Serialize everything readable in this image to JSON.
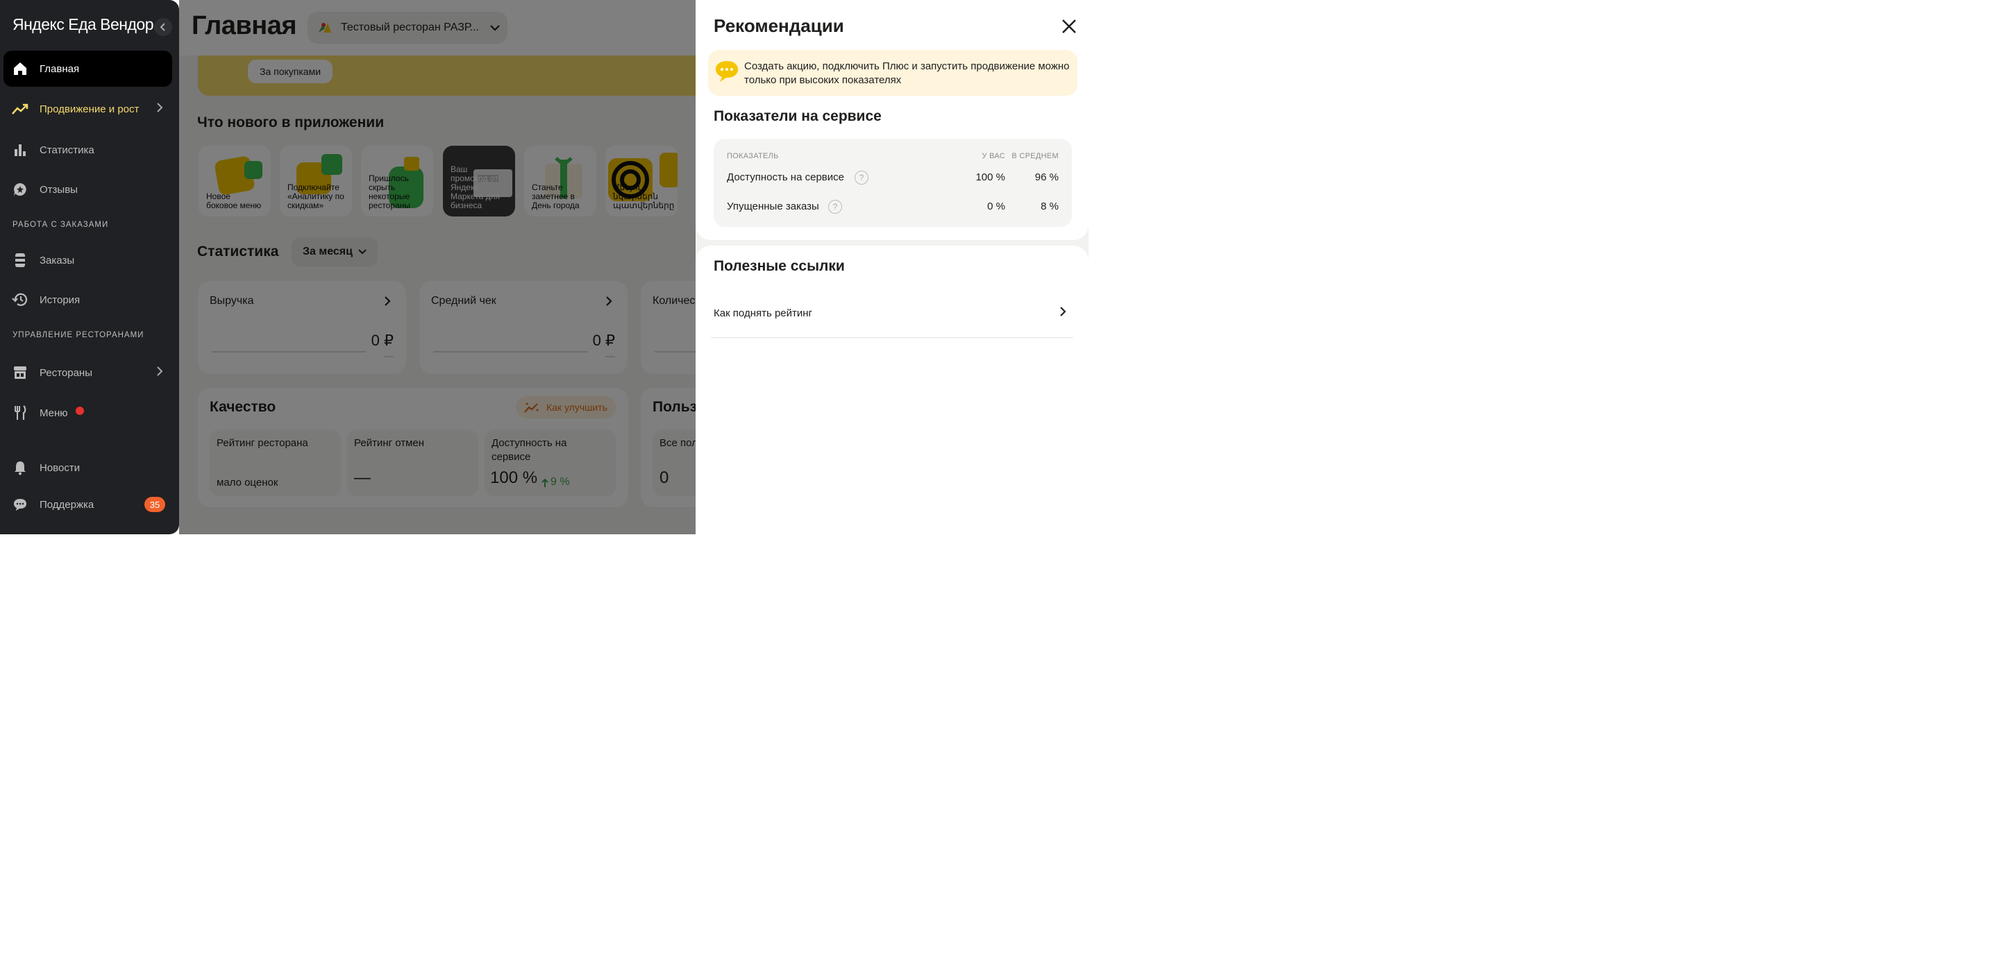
{
  "sidebar": {
    "logo": "Яндекс Еда Вендор",
    "items": [
      {
        "label": "Главная",
        "icon": "home-icon"
      },
      {
        "label": "Продвижение и рост",
        "icon": "trend-icon"
      },
      {
        "label": "Статистика",
        "icon": "chart-icon"
      },
      {
        "label": "Отзывы",
        "icon": "review-icon"
      },
      {
        "label": "Заказы",
        "icon": "orders-icon"
      },
      {
        "label": "История",
        "icon": "history-icon"
      },
      {
        "label": "Рестораны",
        "icon": "restaurant-icon"
      },
      {
        "label": "Меню",
        "icon": "menu-icon"
      },
      {
        "label": "Новости",
        "icon": "bell-icon"
      },
      {
        "label": "Поддержка",
        "icon": "chat-icon",
        "badge": "35"
      }
    ],
    "sections": {
      "orders": "РАБОТА С ЗАКАЗАМИ",
      "restaurants": "УПРАВЛЕНИЕ РЕСТОРАНАМИ"
    },
    "accent_color": "#f5d96a"
  },
  "main": {
    "title": "Главная",
    "restaurant": "Тестовый ресторан РАЗР...",
    "banner_button": "За покупками",
    "whats_new": "Что нового в приложении",
    "stories": [
      "Новое боковое меню",
      "Подключайте «Аналитику по скидкам»",
      "Пришлось скрыть некоторые рестораны",
      "Ваш промокод от Яндекс Маркета для бизнеса",
      "Станьте заметнее в День города",
      "Մենյու նկարներն պատվերները"
    ],
    "stats_title": "Статистика",
    "period": "За месяц",
    "cards": [
      {
        "title": "Выручка",
        "value": "0 ₽"
      },
      {
        "title": "Средний чек",
        "value": "0 ₽"
      },
      {
        "title": "Количес"
      }
    ],
    "quality": {
      "title": "Качество",
      "improve": "Как улучшить",
      "rating": {
        "title": "Рейтинг ресторана",
        "value": "мало оценок"
      },
      "cancel": {
        "title": "Рейтинг отмен",
        "value": "—"
      },
      "availability": {
        "title": "Доступность на сервисе",
        "value": "100 %",
        "delta": "9 %"
      }
    },
    "users": {
      "title": "Польз",
      "sub": "Все пол",
      "value": "0"
    }
  },
  "panel": {
    "title": "Рекомендации",
    "notice": "Создать акцию, подключить Плюс и запустить продвижение можно только при высоких показателях",
    "metrics_title": "Показатели на сервисе",
    "headers": {
      "metric": "ПОКАЗАТЕЛЬ",
      "yours": "У ВАС",
      "avg": "В СРЕДНЕМ"
    },
    "rows": [
      {
        "label": "Доступность на сервисе",
        "yours": "100 %",
        "avg": "96 %"
      },
      {
        "label": "Упущенные заказы",
        "yours": "0 %",
        "avg": "8 %"
      }
    ],
    "links_title": "Полезные ссылки",
    "links": [
      "Как поднять рейтинг"
    ]
  }
}
